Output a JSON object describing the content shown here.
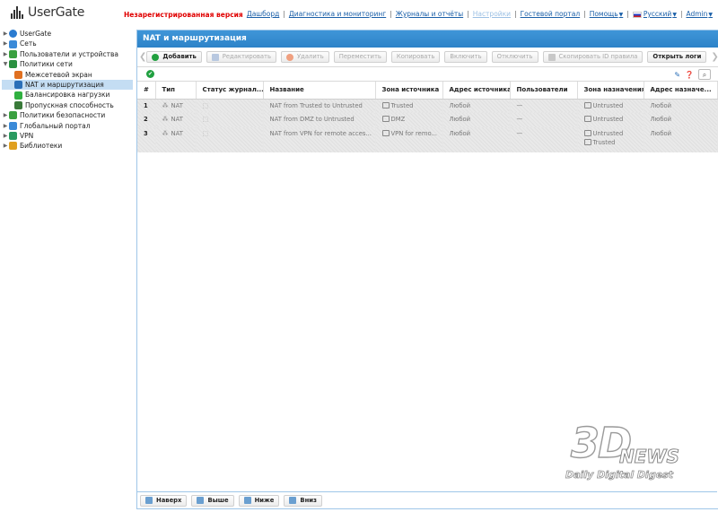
{
  "app": {
    "logo_text": "UserGate",
    "unregistered": "Незарегистрированная версия"
  },
  "topnav": {
    "items": [
      "Дашборд",
      "Диагностика и мониторинг",
      "Журналы и отчёты",
      "Настройки",
      "Гостевой портал",
      "Помощь",
      "Русский",
      "Admin"
    ],
    "active_dim": "Настройки"
  },
  "sidebar": {
    "items": [
      {
        "label": "UserGate",
        "icon": "globe-icon",
        "color": "#2a7bd0"
      },
      {
        "label": "Сеть",
        "icon": "network-icon",
        "color": "#3a8ad8"
      },
      {
        "label": "Пользователи и устройства",
        "icon": "users-icon",
        "color": "#3aa040"
      },
      {
        "label": "Политики сети",
        "icon": "policy-icon",
        "color": "#2a9040"
      },
      {
        "label": "Межсетевой экран",
        "icon": "firewall-icon",
        "color": "#e07020"
      },
      {
        "label": "NAT и маршрутизация",
        "icon": "nat-icon",
        "color": "#2b6fb8"
      },
      {
        "label": "Балансировка нагрузки",
        "icon": "balance-icon",
        "color": "#30b040"
      },
      {
        "label": "Пропускная способность",
        "icon": "bandwidth-icon",
        "color": "#3a7a3a"
      },
      {
        "label": "Политики безопасности",
        "icon": "security-icon",
        "color": "#3aa040"
      },
      {
        "label": "Глобальный портал",
        "icon": "portal-icon",
        "color": "#3a8ad8"
      },
      {
        "label": "VPN",
        "icon": "vpn-icon",
        "color": "#2a9a60"
      },
      {
        "label": "Библиотеки",
        "icon": "library-icon",
        "color": "#e0a020"
      }
    ]
  },
  "panel": {
    "title": "NAT и маршрутизация"
  },
  "toolbar": {
    "add": "Добавить",
    "edit": "Редактировать",
    "delete": "Удалить",
    "move": "Переместить",
    "copy": "Копировать",
    "enable": "Включить",
    "disable": "Отключить",
    "copy_id": "Скопировать ID правила",
    "open_logs": "Открыть логи"
  },
  "table": {
    "headers": [
      "#",
      "Тип",
      "Статус журнал...",
      "Название",
      "Зона источника",
      "Адрес источника",
      "Пользователи",
      "Зона назначения",
      "Адрес назначе..."
    ],
    "rows": [
      {
        "num": "1",
        "type": "NAT",
        "status": "",
        "name": "NAT from Trusted to Untrusted",
        "src_zone": "Trusted",
        "src_addr": "Любой",
        "users": "—",
        "dst_zone": [
          "Untrusted"
        ],
        "dst_addr": "Любой"
      },
      {
        "num": "2",
        "type": "NAT",
        "status": "",
        "name": "NAT from DMZ to Untrusted",
        "src_zone": "DMZ",
        "src_addr": "Любой",
        "users": "—",
        "dst_zone": [
          "Untrusted"
        ],
        "dst_addr": "Любой"
      },
      {
        "num": "3",
        "type": "NAT",
        "status": "",
        "name": "NAT from VPN for remote acces...",
        "src_zone": "VPN for remo...",
        "src_addr": "Любой",
        "users": "—",
        "dst_zone": [
          "Untrusted",
          "Trusted"
        ],
        "dst_addr": "Любой"
      }
    ]
  },
  "bottombar": {
    "top": "Наверх",
    "up": "Выше",
    "down": "Ниже",
    "bottom": "Вниз"
  },
  "watermark": {
    "big": "3D",
    "news": "NEWS",
    "sub": "Daily Digital Digest"
  }
}
